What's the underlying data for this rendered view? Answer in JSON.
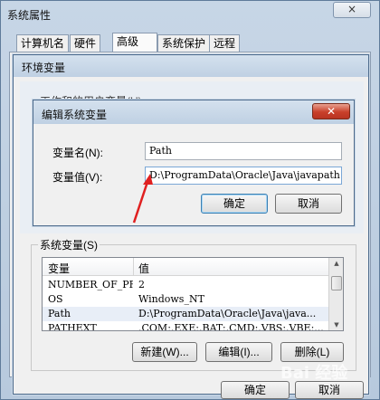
{
  "outer_window": {
    "title": "系统属性",
    "close_label": "×",
    "tabs": [
      "计算机名",
      "硬件",
      "高级",
      "系统保护",
      "远程"
    ],
    "active_tab": "高级",
    "ok_label": "确定",
    "cancel_label": "取消"
  },
  "env_window": {
    "title": "环境变量",
    "user_vars_label": "工作和的用户变量(U)",
    "system_vars_label": "系统变量(S)",
    "columns": [
      "变量",
      "值"
    ],
    "rows": [
      {
        "name": "NUMBER_OF_PR...",
        "value": "2"
      },
      {
        "name": "OS",
        "value": "Windows_NT"
      },
      {
        "name": "Path",
        "value": "D:\\ProgramData\\Oracle\\Java\\java..."
      },
      {
        "name": "PATHEXT",
        "value": ".COM;.EXE;.BAT;.CMD;.VBS;.VBE;..."
      }
    ],
    "new_label": "新建(W)...",
    "edit_label": "编辑(I)...",
    "delete_label": "删除(L)"
  },
  "edit_dialog": {
    "title": "编辑系统变量",
    "close_label": "✕",
    "name_label": "变量名(N):",
    "value_label": "变量值(V):",
    "name_value": "Path",
    "value_value": "D:\\ProgramData\\Oracle\\Java\\javapath",
    "ok_label": "确定",
    "cancel_label": "取消"
  },
  "watermark": "Bai 经验"
}
